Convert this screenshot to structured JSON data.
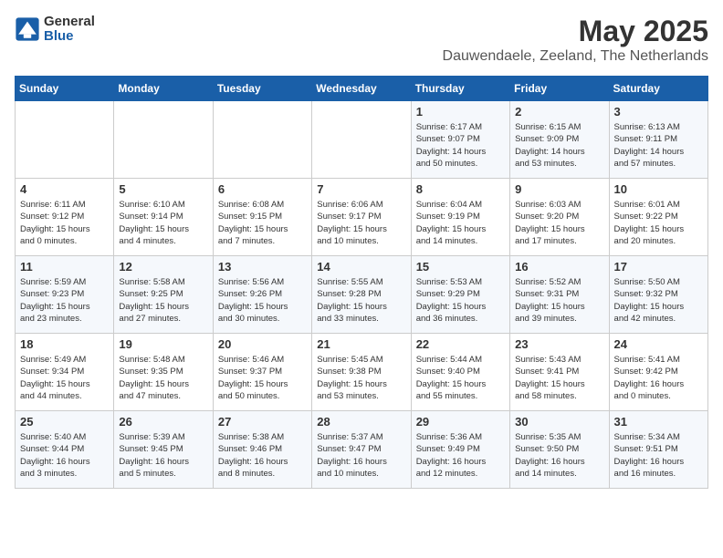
{
  "logo": {
    "text_general": "General",
    "text_blue": "Blue"
  },
  "header": {
    "month": "May 2025",
    "location": "Dauwendaele, Zeeland, The Netherlands"
  },
  "weekdays": [
    "Sunday",
    "Monday",
    "Tuesday",
    "Wednesday",
    "Thursday",
    "Friday",
    "Saturday"
  ],
  "weeks": [
    [
      {
        "day": "",
        "detail": ""
      },
      {
        "day": "",
        "detail": ""
      },
      {
        "day": "",
        "detail": ""
      },
      {
        "day": "",
        "detail": ""
      },
      {
        "day": "1",
        "detail": "Sunrise: 6:17 AM\nSunset: 9:07 PM\nDaylight: 14 hours\nand 50 minutes."
      },
      {
        "day": "2",
        "detail": "Sunrise: 6:15 AM\nSunset: 9:09 PM\nDaylight: 14 hours\nand 53 minutes."
      },
      {
        "day": "3",
        "detail": "Sunrise: 6:13 AM\nSunset: 9:11 PM\nDaylight: 14 hours\nand 57 minutes."
      }
    ],
    [
      {
        "day": "4",
        "detail": "Sunrise: 6:11 AM\nSunset: 9:12 PM\nDaylight: 15 hours\nand 0 minutes."
      },
      {
        "day": "5",
        "detail": "Sunrise: 6:10 AM\nSunset: 9:14 PM\nDaylight: 15 hours\nand 4 minutes."
      },
      {
        "day": "6",
        "detail": "Sunrise: 6:08 AM\nSunset: 9:15 PM\nDaylight: 15 hours\nand 7 minutes."
      },
      {
        "day": "7",
        "detail": "Sunrise: 6:06 AM\nSunset: 9:17 PM\nDaylight: 15 hours\nand 10 minutes."
      },
      {
        "day": "8",
        "detail": "Sunrise: 6:04 AM\nSunset: 9:19 PM\nDaylight: 15 hours\nand 14 minutes."
      },
      {
        "day": "9",
        "detail": "Sunrise: 6:03 AM\nSunset: 9:20 PM\nDaylight: 15 hours\nand 17 minutes."
      },
      {
        "day": "10",
        "detail": "Sunrise: 6:01 AM\nSunset: 9:22 PM\nDaylight: 15 hours\nand 20 minutes."
      }
    ],
    [
      {
        "day": "11",
        "detail": "Sunrise: 5:59 AM\nSunset: 9:23 PM\nDaylight: 15 hours\nand 23 minutes."
      },
      {
        "day": "12",
        "detail": "Sunrise: 5:58 AM\nSunset: 9:25 PM\nDaylight: 15 hours\nand 27 minutes."
      },
      {
        "day": "13",
        "detail": "Sunrise: 5:56 AM\nSunset: 9:26 PM\nDaylight: 15 hours\nand 30 minutes."
      },
      {
        "day": "14",
        "detail": "Sunrise: 5:55 AM\nSunset: 9:28 PM\nDaylight: 15 hours\nand 33 minutes."
      },
      {
        "day": "15",
        "detail": "Sunrise: 5:53 AM\nSunset: 9:29 PM\nDaylight: 15 hours\nand 36 minutes."
      },
      {
        "day": "16",
        "detail": "Sunrise: 5:52 AM\nSunset: 9:31 PM\nDaylight: 15 hours\nand 39 minutes."
      },
      {
        "day": "17",
        "detail": "Sunrise: 5:50 AM\nSunset: 9:32 PM\nDaylight: 15 hours\nand 42 minutes."
      }
    ],
    [
      {
        "day": "18",
        "detail": "Sunrise: 5:49 AM\nSunset: 9:34 PM\nDaylight: 15 hours\nand 44 minutes."
      },
      {
        "day": "19",
        "detail": "Sunrise: 5:48 AM\nSunset: 9:35 PM\nDaylight: 15 hours\nand 47 minutes."
      },
      {
        "day": "20",
        "detail": "Sunrise: 5:46 AM\nSunset: 9:37 PM\nDaylight: 15 hours\nand 50 minutes."
      },
      {
        "day": "21",
        "detail": "Sunrise: 5:45 AM\nSunset: 9:38 PM\nDaylight: 15 hours\nand 53 minutes."
      },
      {
        "day": "22",
        "detail": "Sunrise: 5:44 AM\nSunset: 9:40 PM\nDaylight: 15 hours\nand 55 minutes."
      },
      {
        "day": "23",
        "detail": "Sunrise: 5:43 AM\nSunset: 9:41 PM\nDaylight: 15 hours\nand 58 minutes."
      },
      {
        "day": "24",
        "detail": "Sunrise: 5:41 AM\nSunset: 9:42 PM\nDaylight: 16 hours\nand 0 minutes."
      }
    ],
    [
      {
        "day": "25",
        "detail": "Sunrise: 5:40 AM\nSunset: 9:44 PM\nDaylight: 16 hours\nand 3 minutes."
      },
      {
        "day": "26",
        "detail": "Sunrise: 5:39 AM\nSunset: 9:45 PM\nDaylight: 16 hours\nand 5 minutes."
      },
      {
        "day": "27",
        "detail": "Sunrise: 5:38 AM\nSunset: 9:46 PM\nDaylight: 16 hours\nand 8 minutes."
      },
      {
        "day": "28",
        "detail": "Sunrise: 5:37 AM\nSunset: 9:47 PM\nDaylight: 16 hours\nand 10 minutes."
      },
      {
        "day": "29",
        "detail": "Sunrise: 5:36 AM\nSunset: 9:49 PM\nDaylight: 16 hours\nand 12 minutes."
      },
      {
        "day": "30",
        "detail": "Sunrise: 5:35 AM\nSunset: 9:50 PM\nDaylight: 16 hours\nand 14 minutes."
      },
      {
        "day": "31",
        "detail": "Sunrise: 5:34 AM\nSunset: 9:51 PM\nDaylight: 16 hours\nand 16 minutes."
      }
    ]
  ]
}
